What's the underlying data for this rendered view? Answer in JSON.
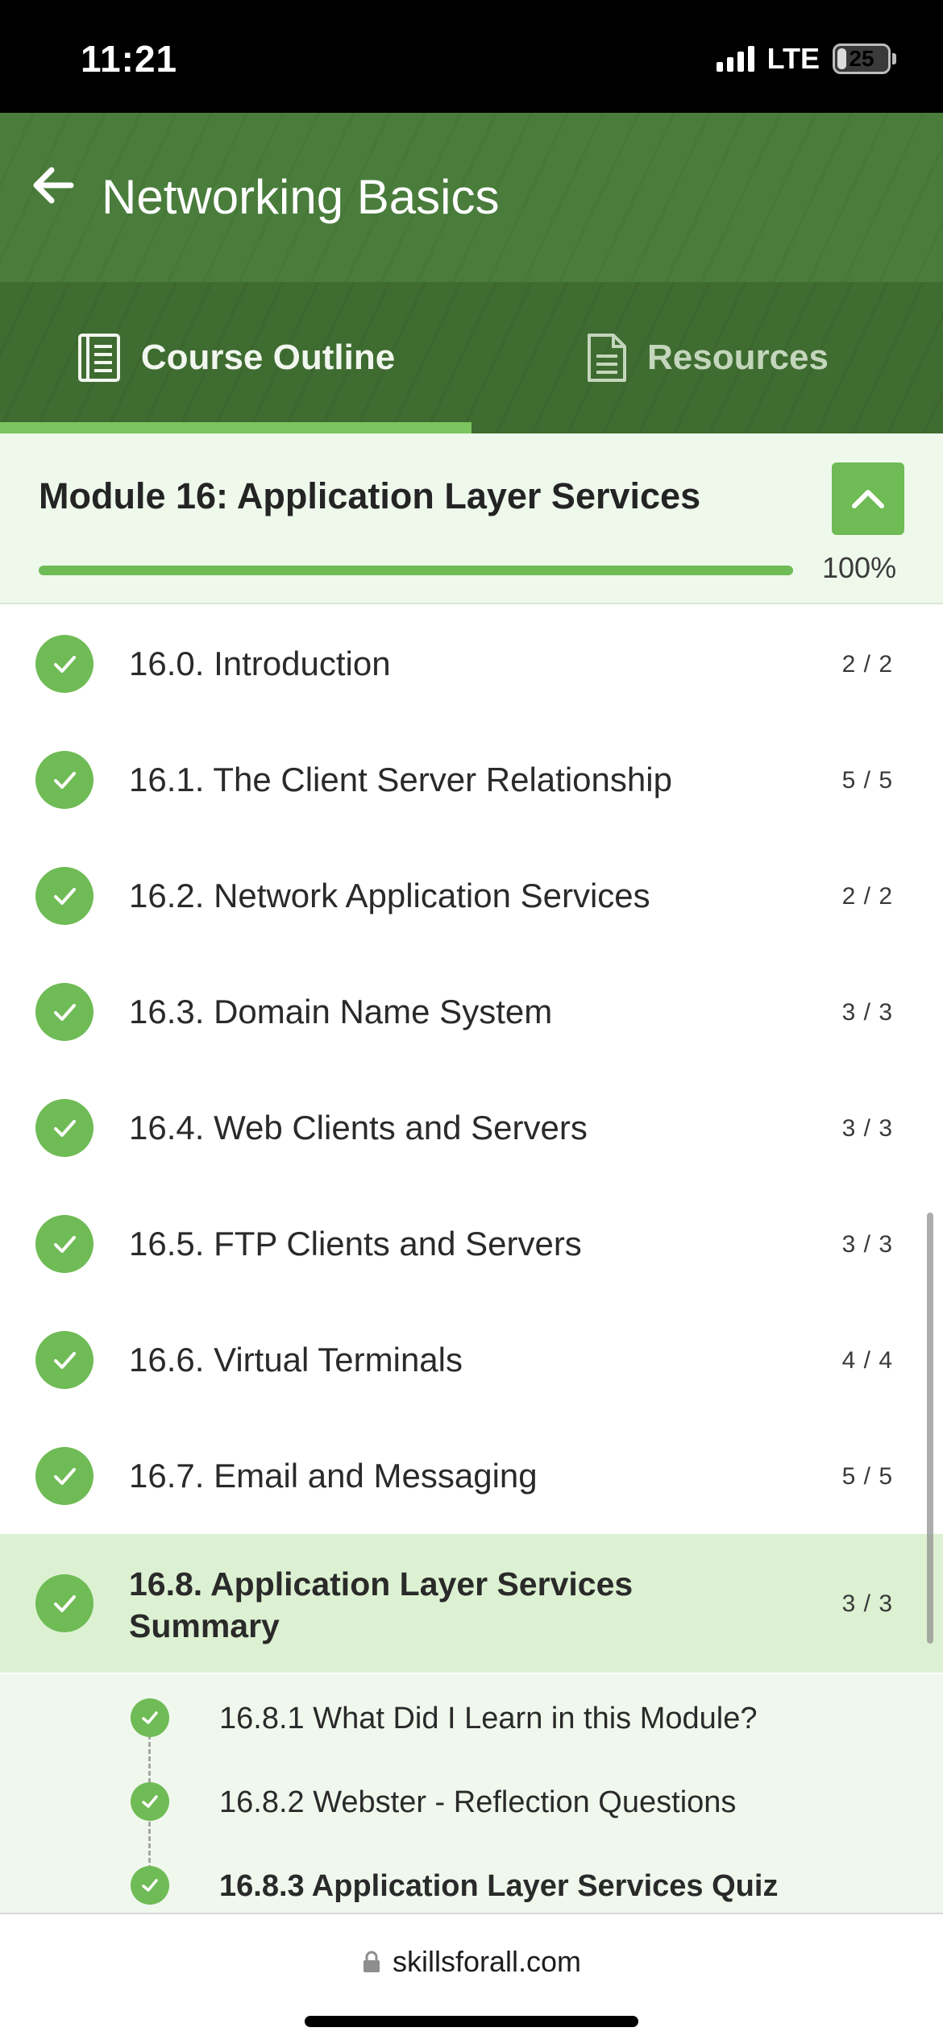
{
  "status_bar": {
    "time": "11:21",
    "network": "LTE",
    "battery": "25"
  },
  "header": {
    "title": "Networking Basics"
  },
  "tabs": [
    {
      "label": "Course Outline",
      "icon": "course-outline-icon",
      "active": true
    },
    {
      "label": "Resources",
      "icon": "document-icon",
      "active": false
    }
  ],
  "module": {
    "title": "Module 16: Application Layer Services",
    "progress": 1.0,
    "progress_label": "100%"
  },
  "lessons": [
    {
      "label": "16.0. Introduction",
      "count": "2 / 2"
    },
    {
      "label": "16.1. The Client Server Relationship",
      "count": "5 / 5"
    },
    {
      "label": "16.2. Network Application Services",
      "count": "2 / 2"
    },
    {
      "label": "16.3. Domain Name System",
      "count": "3 / 3"
    },
    {
      "label": "16.4. Web Clients and Servers",
      "count": "3 / 3"
    },
    {
      "label": "16.5. FTP Clients and Servers",
      "count": "3 / 3"
    },
    {
      "label": "16.6. Virtual Terminals",
      "count": "4 / 4"
    },
    {
      "label": "16.7. Email and Messaging",
      "count": "5 / 5"
    },
    {
      "label": "16.8. Application Layer Services Summary",
      "count": "3 / 3"
    }
  ],
  "subitems": [
    {
      "label": "16.8.1 What Did I Learn in this Module?"
    },
    {
      "label": "16.8.2 Webster - Reflection Questions"
    },
    {
      "label": "16.8.3 Application Layer Services Quiz"
    }
  ],
  "browser": {
    "url": "skillsforall.com"
  },
  "colors": {
    "header_green": "#4a7d3c",
    "tab_green": "#3f6c31",
    "accent_green": "#6fbb55",
    "module_bg": "#eef9ec",
    "current_bg": "#dcf1d2"
  }
}
